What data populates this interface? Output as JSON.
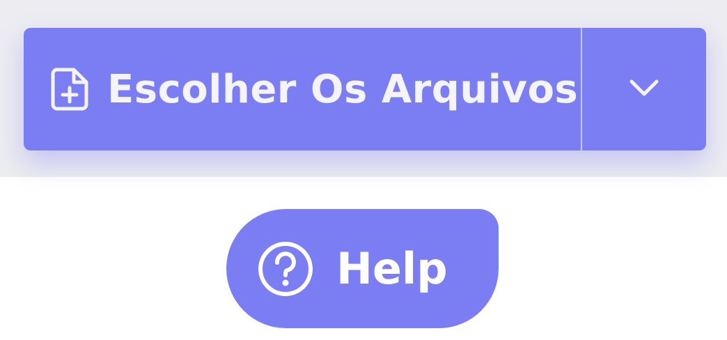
{
  "file_chooser": {
    "label": "Escolher Os Arquivos",
    "icon": "file-plus-icon",
    "dropdown_icon": "chevron-down-icon"
  },
  "help": {
    "label": "Help",
    "icon": "question-circle-icon"
  },
  "colors": {
    "accent": "#7b7df3",
    "top_background": "#ececf1",
    "text": "#f4f4fa"
  }
}
